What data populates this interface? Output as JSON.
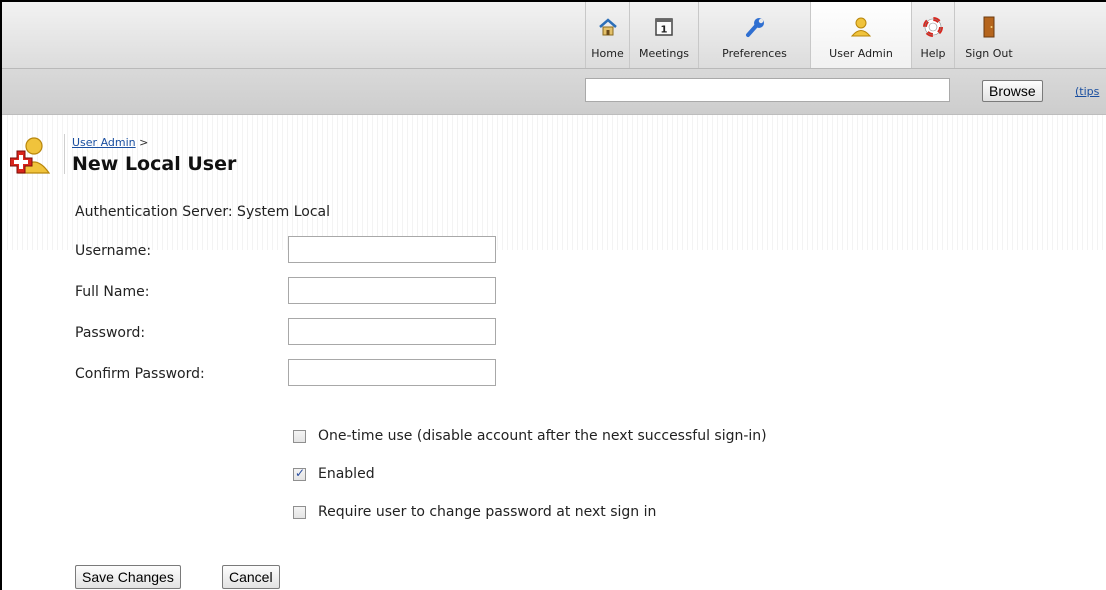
{
  "nav": {
    "tabs": [
      {
        "label": "Home",
        "icon": "home-icon"
      },
      {
        "label": "Meetings",
        "icon": "calendar-icon"
      },
      {
        "label": "Preferences",
        "icon": "wrench-icon"
      },
      {
        "label": "User Admin",
        "icon": "user-icon",
        "active": true
      },
      {
        "label": "Help",
        "icon": "lifebuoy-icon"
      },
      {
        "label": "Sign Out",
        "icon": "door-icon"
      }
    ]
  },
  "search": {
    "value": "",
    "browse_label": "Browse",
    "tips_label": "(tips"
  },
  "page": {
    "breadcrumb_link": "User Admin",
    "breadcrumb_sep": " >",
    "title": "New Local User",
    "auth_server": "Authentication Server: System Local"
  },
  "form": {
    "username_label": "Username:",
    "fullname_label": "Full Name:",
    "password_label": "Password:",
    "confirm_label": "Confirm Password:",
    "onetime_label": "One-time use (disable account after the next successful sign-in)",
    "onetime_checked": false,
    "enabled_label": "Enabled",
    "enabled_checked": true,
    "require_label": "Require user to change password at next sign in",
    "require_checked": false
  },
  "actions": {
    "save_label": "Save Changes",
    "cancel_label": "Cancel"
  },
  "colors": {
    "link": "#1a4fa0",
    "icon_gold": "#e5b52a",
    "icon_blue": "#2f6fd1",
    "icon_red": "#d9251c"
  }
}
